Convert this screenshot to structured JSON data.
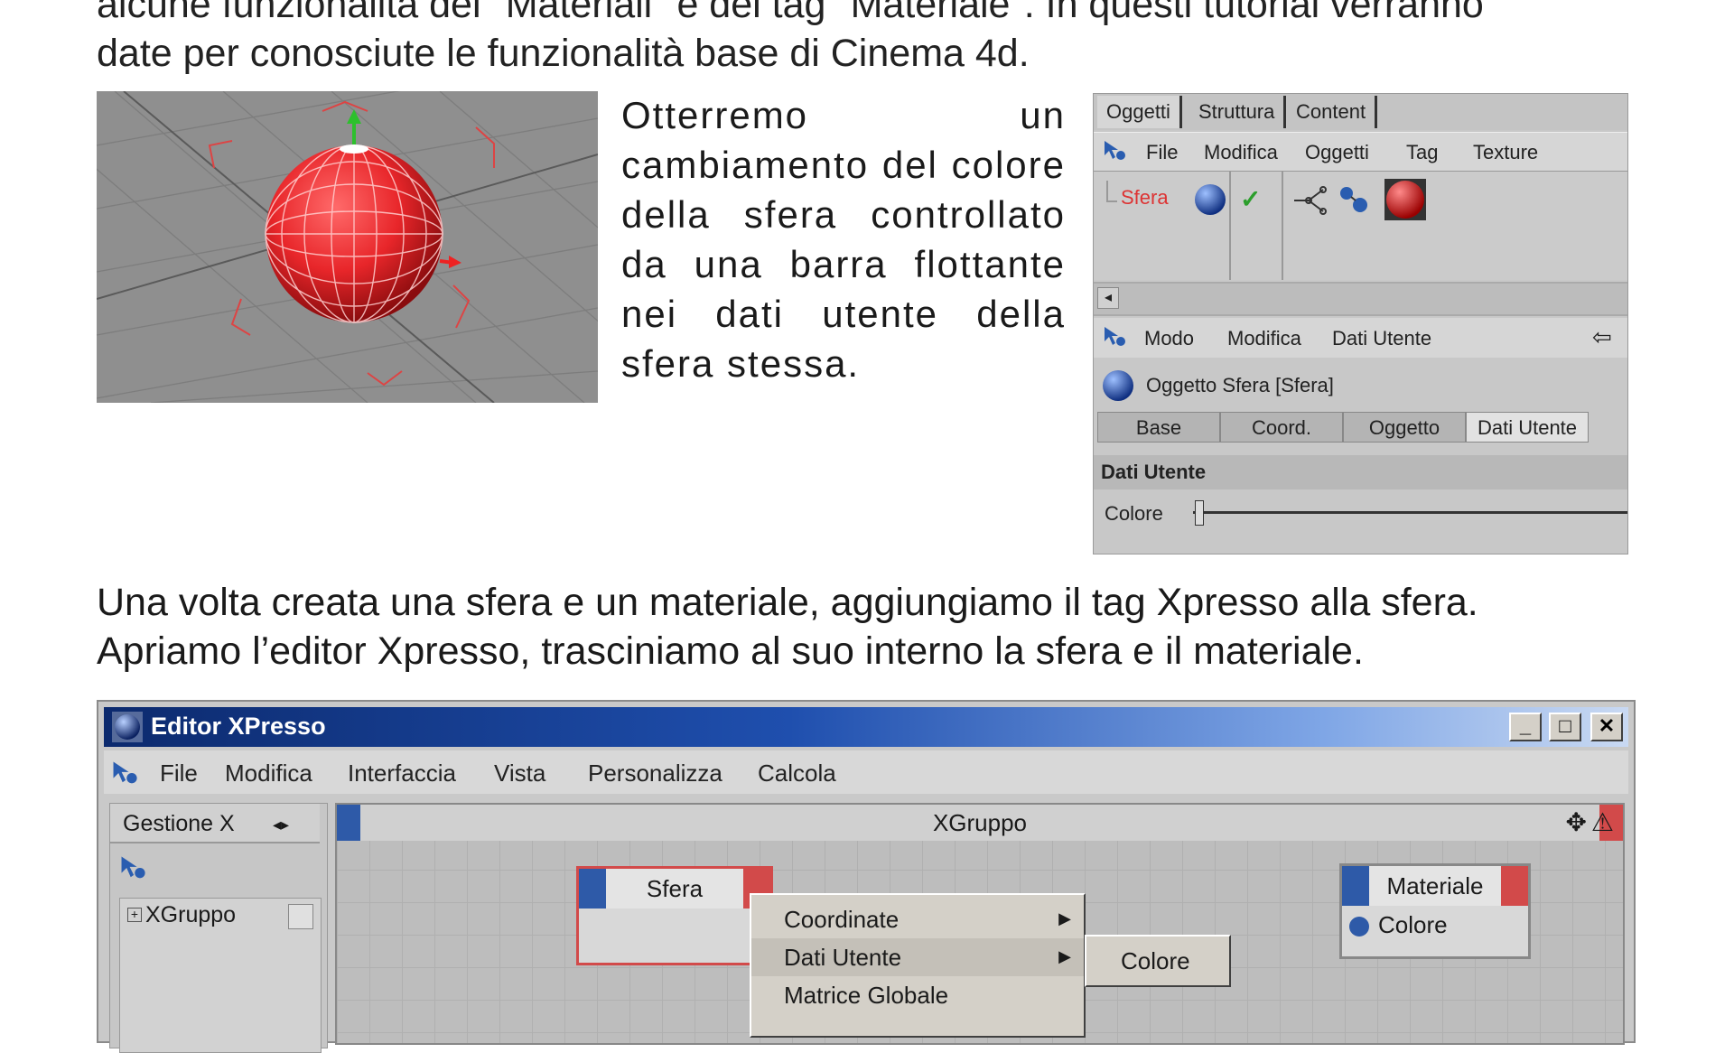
{
  "intro": {
    "line1": "alcune funzionalità del \"Materiali\" e del tag \"Materiale\". In questi tutorial verranno",
    "line2": "date per conosciute le funzionalità base di Cinema 4d."
  },
  "description": "Otterremo un cambiamento del colore della sfera controllato da una barra flottante nei dati utente della sfera stessa.",
  "object_manager": {
    "tabs": [
      "Oggetti",
      "Struttura",
      "Content"
    ],
    "menu": [
      "File",
      "Modifica",
      "Oggetti",
      "Tag",
      "Texture"
    ],
    "object_name": "Sfera",
    "attr_menu": [
      "Modo",
      "Modifica",
      "Dati Utente"
    ],
    "object_title": "Oggetto Sfera [Sfera]",
    "subtabs": [
      "Base",
      "Coord.",
      "Oggetto",
      "Dati Utente"
    ],
    "group_title": "Dati Utente",
    "slider_label": "Colore"
  },
  "paragraph2": {
    "line1": "Una volta creata una sfera e un materiale, aggiungiamo il tag Xpresso alla sfera.",
    "line2": "Apriamo l’editor Xpresso, trasciniamo al suo interno la sfera e il materiale."
  },
  "xpresso": {
    "title": "Editor XPresso",
    "window_buttons": [
      "_",
      "□",
      "✕"
    ],
    "menu": [
      "File",
      "Modifica",
      "Interfaccia",
      "Vista",
      "Personalizza",
      "Calcola"
    ],
    "left_tab": "Gestione X",
    "tree_item": "XGruppo",
    "canvas_title": "XGruppo",
    "node_sfera": "Sfera",
    "node_materiale": "Materiale",
    "node_materiale_port": "Colore",
    "context_menu": [
      "Coordinate",
      "Dati Utente",
      "Matrice Globale"
    ],
    "submenu": [
      "Colore"
    ]
  },
  "colors": {
    "sphere_red": "#e8262a",
    "node_border": "#d24a4a",
    "port_blue": "#2e5aa8",
    "titlebar": "#1f4fae"
  }
}
